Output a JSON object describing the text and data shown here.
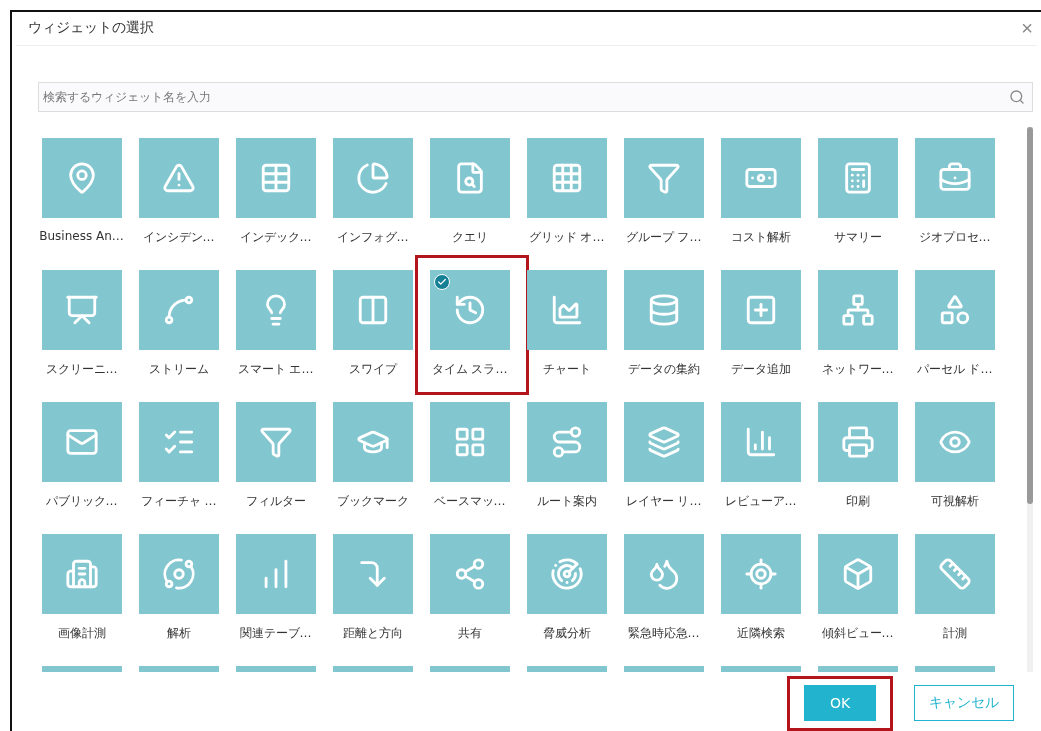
{
  "dialog": {
    "title": "ウィジェットの選択",
    "close": "×"
  },
  "search": {
    "placeholder": "検索するウィジェット名を入力"
  },
  "widgets": [
    {
      "label": "Business An…",
      "selected": false
    },
    {
      "label": "インシデン…",
      "selected": false
    },
    {
      "label": "インデック…",
      "selected": false
    },
    {
      "label": "インフォグ…",
      "selected": false
    },
    {
      "label": "クエリ",
      "selected": false
    },
    {
      "label": "グリッド オ…",
      "selected": false
    },
    {
      "label": "グループ フ…",
      "selected": false
    },
    {
      "label": "コスト解析",
      "selected": false
    },
    {
      "label": "サマリー",
      "selected": false
    },
    {
      "label": "ジオプロセ…",
      "selected": false
    },
    {
      "label": "スクリーニ…",
      "selected": false
    },
    {
      "label": "ストリーム",
      "selected": false
    },
    {
      "label": "スマート エ…",
      "selected": false
    },
    {
      "label": "スワイプ",
      "selected": false
    },
    {
      "label": "タイム スラ…",
      "selected": true
    },
    {
      "label": "チャート",
      "selected": false
    },
    {
      "label": "データの集約",
      "selected": false
    },
    {
      "label": "データ追加",
      "selected": false
    },
    {
      "label": "ネットワー…",
      "selected": false
    },
    {
      "label": "パーセル ド…",
      "selected": false
    },
    {
      "label": "パブリック…",
      "selected": false
    },
    {
      "label": "フィーチャ …",
      "selected": false
    },
    {
      "label": "フィルター",
      "selected": false
    },
    {
      "label": "ブックマーク",
      "selected": false
    },
    {
      "label": "ベースマッ…",
      "selected": false
    },
    {
      "label": "ルート案内",
      "selected": false
    },
    {
      "label": "レイヤー リ…",
      "selected": false
    },
    {
      "label": "レビューア…",
      "selected": false
    },
    {
      "label": "印刷",
      "selected": false
    },
    {
      "label": "可視解析",
      "selected": false
    },
    {
      "label": "画像計測",
      "selected": false
    },
    {
      "label": "解析",
      "selected": false
    },
    {
      "label": "関連テーブ…",
      "selected": false
    },
    {
      "label": "距離と方向",
      "selected": false
    },
    {
      "label": "共有",
      "selected": false
    },
    {
      "label": "脅威分析",
      "selected": false
    },
    {
      "label": "緊急時応急…",
      "selected": false
    },
    {
      "label": "近隣検索",
      "selected": false
    },
    {
      "label": "傾斜ビュー…",
      "selected": false
    },
    {
      "label": "計測",
      "selected": false
    },
    {
      "selected": false
    },
    {
      "selected": false
    },
    {
      "selected": false
    },
    {
      "selected": false
    },
    {
      "selected": false
    },
    {
      "selected": false
    },
    {
      "selected": false
    },
    {
      "selected": false
    },
    {
      "selected": false
    },
    {
      "selected": false
    }
  ],
  "buttons": [
    {
      "label": "OK",
      "kind": "primary",
      "highlighted": true
    },
    {
      "label": "キャンセル",
      "kind": "secondary"
    }
  ]
}
